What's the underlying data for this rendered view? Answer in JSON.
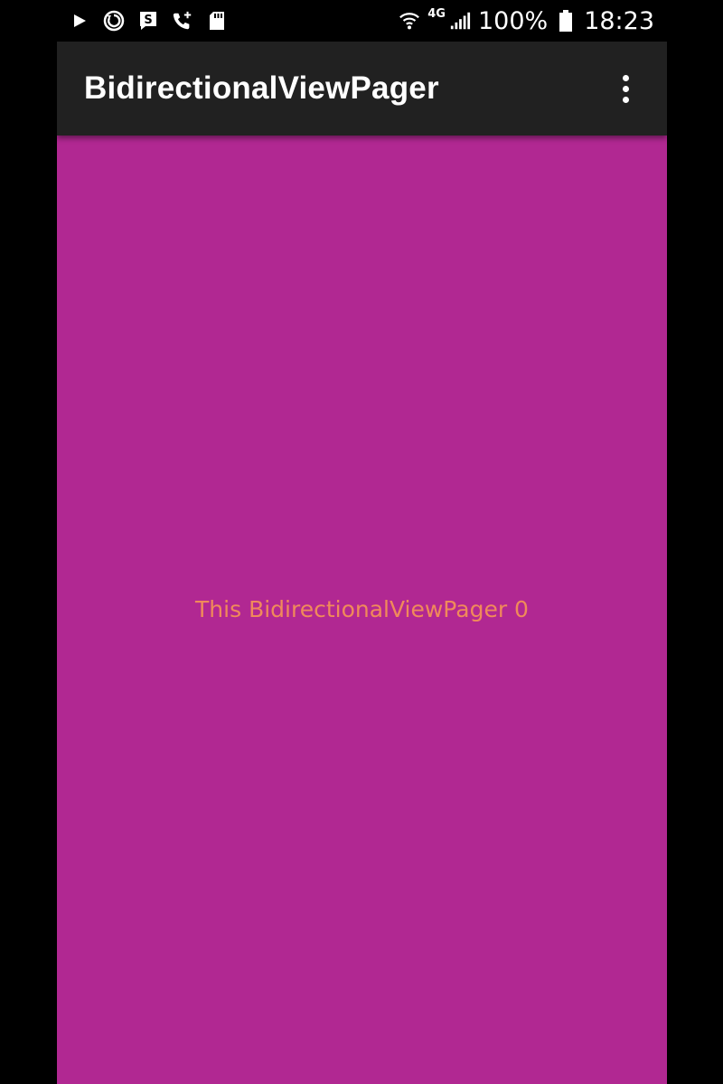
{
  "status_bar": {
    "icons_left": [
      "play-icon",
      "sync-icon",
      "s-badge-icon",
      "call-add-icon",
      "sd-card-icon"
    ],
    "icons_right": [
      "wifi-icon",
      "signal-icon",
      "battery-icon"
    ],
    "network": "4G",
    "battery_percent": "100%",
    "time": "18:23",
    "icon_color": "#ffffff"
  },
  "app_bar": {
    "title": "BidirectionalViewPager",
    "menu_icon": "more-vert-icon",
    "background": "#212121"
  },
  "pager": {
    "page_text": "This BidirectionalViewPager 0",
    "background": "#b12892",
    "text_color": "#f08a5a"
  }
}
